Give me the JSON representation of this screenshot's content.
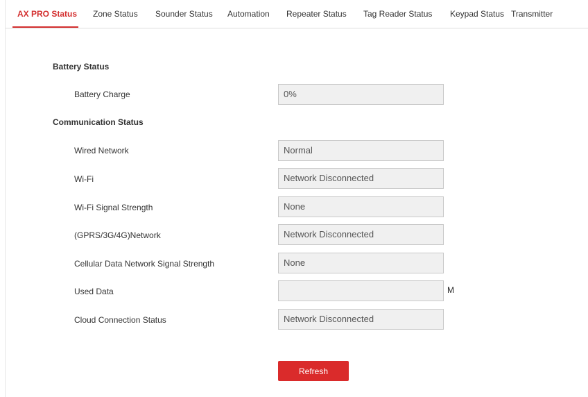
{
  "tabs": [
    {
      "label": "AX PRO Status"
    },
    {
      "label": "Zone Status"
    },
    {
      "label": "Sounder Status"
    },
    {
      "label": "Automation"
    },
    {
      "label": "Repeater Status"
    },
    {
      "label": "Tag Reader Status"
    },
    {
      "label": "Keypad Status"
    },
    {
      "label": "Transmitter"
    }
  ],
  "active_tab": "AX PRO Status",
  "battery_section": {
    "title": "Battery Status",
    "battery_charge": {
      "label": "Battery Charge",
      "value": "0%"
    }
  },
  "communication_section": {
    "title": "Communication Status",
    "wired_network": {
      "label": "Wired Network",
      "value": "Normal"
    },
    "wifi": {
      "label": "Wi-Fi",
      "value": "Network Disconnected"
    },
    "wifi_signal": {
      "label": "Wi-Fi Signal Strength",
      "value": "None"
    },
    "cellular_network": {
      "label": "(GPRS/3G/4G)Network",
      "value": "Network Disconnected"
    },
    "cellular_signal": {
      "label": "Cellular Data Network Signal Strength",
      "value": "None"
    },
    "used_data": {
      "label": "Used Data",
      "value": "",
      "unit": "M"
    },
    "cloud_status": {
      "label": "Cloud Connection Status",
      "value": "Network Disconnected"
    }
  },
  "refresh_label": "Refresh",
  "colors": {
    "accent": "#d32f2f",
    "button": "#da2b2b",
    "field_bg": "#f0f0f0"
  }
}
